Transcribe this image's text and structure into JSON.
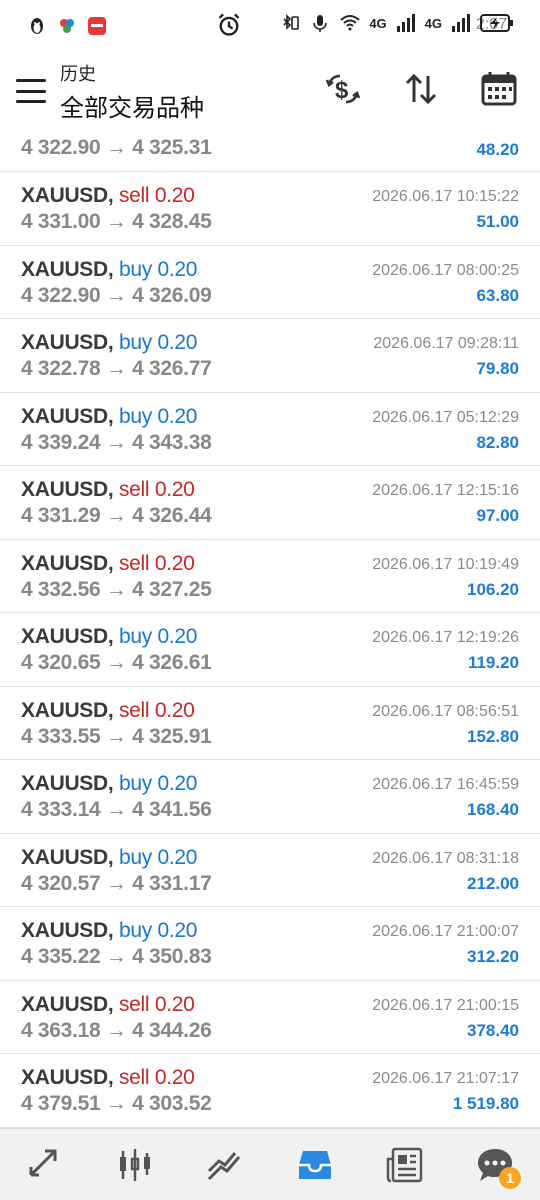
{
  "status_bar": {
    "time": "2:07",
    "signal_1": "4G",
    "signal_2": "4G"
  },
  "toolbar": {
    "title_small": "历史",
    "title_big": "全部交易品种",
    "icons": [
      "dollar-swap-icon",
      "sort-icon",
      "calendar-icon"
    ]
  },
  "colors": {
    "buy": "#1976d2",
    "sell": "#c62828",
    "profit": "#1e7bd6",
    "price": "#888888",
    "active_nav": "#2a8ae0"
  },
  "trades": [
    {
      "symbol": "",
      "direction": "",
      "type": "",
      "volume": "",
      "prices": "4 322.90 → 4 325.31",
      "time": "",
      "profit": "48.20"
    },
    {
      "symbol": "XAUUSD,",
      "direction": "sell",
      "type": "sell",
      "volume": "0.20",
      "prices": "4 331.00 → 4 328.45",
      "time": "2026.06.17 10:15:22",
      "profit": "51.00"
    },
    {
      "symbol": "XAUUSD,",
      "direction": "buy",
      "type": "buy",
      "volume": "0.20",
      "prices": "4 322.90 → 4 326.09",
      "time": "2026.06.17 08:00:25",
      "profit": "63.80"
    },
    {
      "symbol": "XAUUSD,",
      "direction": "buy",
      "type": "buy",
      "volume": "0.20",
      "prices": "4 322.78 → 4 326.77",
      "time": "2026.06.17 09:28:11",
      "profit": "79.80"
    },
    {
      "symbol": "XAUUSD,",
      "direction": "buy",
      "type": "buy",
      "volume": "0.20",
      "prices": "4 339.24 → 4 343.38",
      "time": "2026.06.17 05:12:29",
      "profit": "82.80"
    },
    {
      "symbol": "XAUUSD,",
      "direction": "sell",
      "type": "sell",
      "volume": "0.20",
      "prices": "4 331.29 → 4 326.44",
      "time": "2026.06.17 12:15:16",
      "profit": "97.00"
    },
    {
      "symbol": "XAUUSD,",
      "direction": "sell",
      "type": "sell",
      "volume": "0.20",
      "prices": "4 332.56 → 4 327.25",
      "time": "2026.06.17 10:19:49",
      "profit": "106.20"
    },
    {
      "symbol": "XAUUSD,",
      "direction": "buy",
      "type": "buy",
      "volume": "0.20",
      "prices": "4 320.65 → 4 326.61",
      "time": "2026.06.17 12:19:26",
      "profit": "119.20"
    },
    {
      "symbol": "XAUUSD,",
      "direction": "sell",
      "type": "sell",
      "volume": "0.20",
      "prices": "4 333.55 → 4 325.91",
      "time": "2026.06.17 08:56:51",
      "profit": "152.80"
    },
    {
      "symbol": "XAUUSD,",
      "direction": "buy",
      "type": "buy",
      "volume": "0.20",
      "prices": "4 333.14 → 4 341.56",
      "time": "2026.06.17 16:45:59",
      "profit": "168.40"
    },
    {
      "symbol": "XAUUSD,",
      "direction": "buy",
      "type": "buy",
      "volume": "0.20",
      "prices": "4 320.57 → 4 331.17",
      "time": "2026.06.17 08:31:18",
      "profit": "212.00"
    },
    {
      "symbol": "XAUUSD,",
      "direction": "buy",
      "type": "buy",
      "volume": "0.20",
      "prices": "4 335.22 → 4 350.83",
      "time": "2026.06.17 21:00:07",
      "profit": "312.20"
    },
    {
      "symbol": "XAUUSD,",
      "direction": "sell",
      "type": "sell",
      "volume": "0.20",
      "prices": "4 363.18 → 4 344.26",
      "time": "2026.06.17 21:00:15",
      "profit": "378.40"
    },
    {
      "symbol": "XAUUSD,",
      "direction": "sell",
      "type": "sell",
      "volume": "0.20",
      "prices": "4 379.51 → 4 303.52",
      "time": "2026.06.17 21:07:17",
      "profit": "1 519.80"
    }
  ],
  "bottom_nav": {
    "items": [
      "quotes-icon",
      "chart-icon",
      "trade-icon",
      "history-icon",
      "news-icon",
      "messages-icon"
    ],
    "active": "history-icon",
    "messages_badge": "1"
  }
}
